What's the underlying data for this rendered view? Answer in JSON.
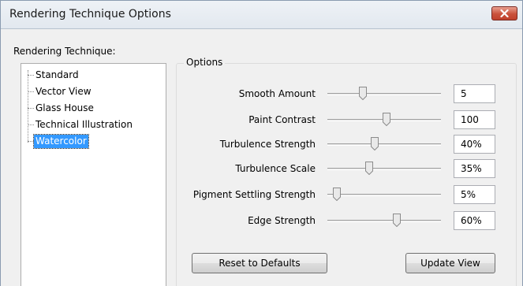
{
  "window": {
    "title": "Rendering Technique Options"
  },
  "technique": {
    "label": "Rendering Technique:",
    "items": [
      {
        "label": "Standard",
        "selected": false
      },
      {
        "label": "Vector View",
        "selected": false
      },
      {
        "label": "Glass House",
        "selected": false
      },
      {
        "label": "Technical Illustration",
        "selected": false
      },
      {
        "label": "Watercolor",
        "selected": true
      }
    ]
  },
  "options": {
    "legend": "Options",
    "rows": [
      {
        "label": "Smooth Amount",
        "value": "5",
        "level": 0.31
      },
      {
        "label": "Paint Contrast",
        "value": "100",
        "level": 0.52
      },
      {
        "label": "Turbulence Strength",
        "value": "40%",
        "level": 0.42
      },
      {
        "label": "Turbulence Scale",
        "value": "35%",
        "level": 0.37
      },
      {
        "label": "Pigment Settling Strength",
        "value": "5%",
        "level": 0.08
      },
      {
        "label": "Edge Strength",
        "value": "60%",
        "level": 0.61
      }
    ]
  },
  "buttons": {
    "reset": "Reset to Defaults",
    "update": "Update View"
  }
}
